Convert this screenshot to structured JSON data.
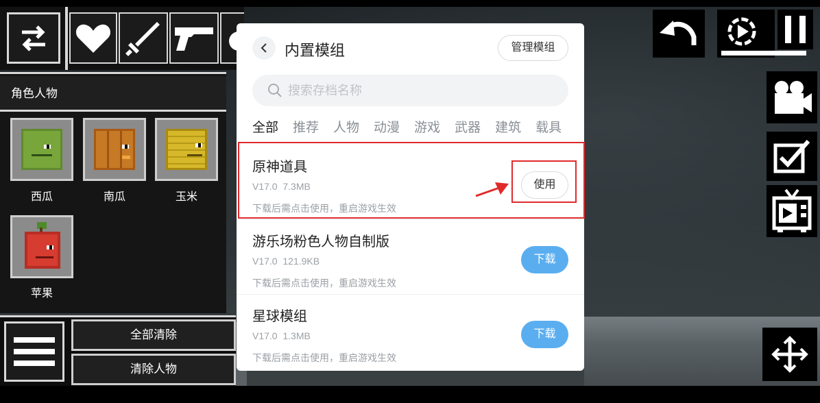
{
  "colors": {
    "accent_download": "#5aaef0",
    "annotation_red": "#e02a2a"
  },
  "left_panel": {
    "top_icons": [
      "swap-icon",
      "heart-icon",
      "sword-icon",
      "pistol-icon",
      "bomb-icon"
    ],
    "category_title": "角色人物",
    "items": [
      {
        "label": "西瓜",
        "icon": "watermelon-icon"
      },
      {
        "label": "南瓜",
        "icon": "pumpkin-icon"
      },
      {
        "label": "玉米",
        "icon": "corn-icon"
      },
      {
        "label": "苹果",
        "icon": "apple-icon"
      }
    ],
    "menu_icon": "hamburger-icon",
    "clear_all_label": "全部清除",
    "clear_people_label": "清除人物"
  },
  "right_controls": [
    "undo-icon",
    "slow-motion-icon",
    "pause-icon",
    "camera-icon",
    "checkbox-icon",
    "tv-icon",
    "move-icon"
  ],
  "dialog": {
    "title": "内置模组",
    "manage_label": "管理模组",
    "search_placeholder": "搜索存档名称",
    "tabs": [
      "全部",
      "推荐",
      "人物",
      "动漫",
      "游戏",
      "武器",
      "建筑",
      "载具"
    ],
    "mods": [
      {
        "name": "原神道具",
        "version": "V17.0",
        "size": "7.3MB",
        "note": "下载后需点击使用，重启游戏生效",
        "action": "使用"
      },
      {
        "name": "游乐场粉色人物自制版",
        "version": "V17.0",
        "size": "121.9KB",
        "note": "下载后需点击使用，重启游戏生效",
        "action": "下载"
      },
      {
        "name": "星球模组",
        "version": "V17.0",
        "size": "1.3MB",
        "note": "下载后需点击使用，重启游戏生效",
        "action": "下载"
      }
    ]
  }
}
